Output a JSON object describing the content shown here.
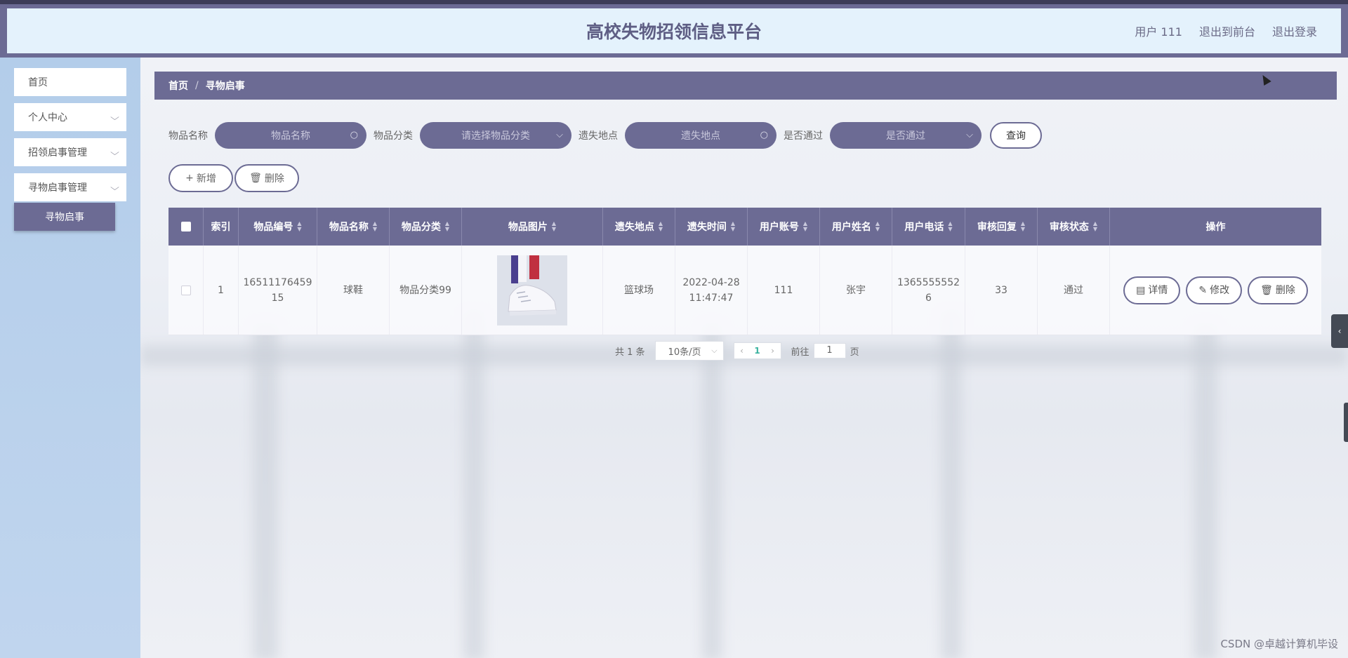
{
  "header": {
    "title": "高校失物招领信息平台",
    "user_label": "用户 111",
    "to_front_label": "退出到前台",
    "logout_label": "退出登录"
  },
  "sidebar": {
    "items": [
      {
        "label": "首页"
      },
      {
        "label": "个人中心"
      },
      {
        "label": "招领启事管理"
      },
      {
        "label": "寻物启事管理"
      }
    ],
    "submenu_active": "寻物启事"
  },
  "breadcrumb": {
    "home": "首页",
    "sep": "/",
    "current": "寻物启事"
  },
  "search": {
    "name_label": "物品名称",
    "name_placeholder": "物品名称",
    "category_label": "物品分类",
    "category_placeholder": "请选择物品分类",
    "place_label": "遗失地点",
    "place_placeholder": "遗失地点",
    "passed_label": "是否通过",
    "passed_placeholder": "是否通过",
    "query_label": "查询"
  },
  "toolbar": {
    "add_label": "新增",
    "delete_label": "删除"
  },
  "table": {
    "headers": [
      "索引",
      "物品编号",
      "物品名称",
      "物品分类",
      "物品图片",
      "遗失地点",
      "遗失时间",
      "用户账号",
      "用户姓名",
      "用户电话",
      "审核回复",
      "审核状态",
      "操作"
    ],
    "rows": [
      {
        "index": "1",
        "code": "1651117645915",
        "name": "球鞋",
        "category": "物品分类99",
        "place": "篮球场",
        "time": "2022-04-28 11:47:47",
        "account": "111",
        "username": "张宇",
        "phone": "13655555526",
        "reply": "33",
        "status": "通过"
      }
    ],
    "op_detail": "详情",
    "op_edit": "修改",
    "op_delete": "删除"
  },
  "pagination": {
    "total": "共 1 条",
    "page_size": "10条/页",
    "current_page": "1",
    "goto_label": "前往",
    "goto_value": "1",
    "page_suffix": "页"
  },
  "watermark": "CSDN @卓越计算机毕设",
  "colors": {
    "accent": "#6c6b94",
    "header_bg": "#e4f2fc",
    "sidebar_bg": "#b3cdea"
  }
}
